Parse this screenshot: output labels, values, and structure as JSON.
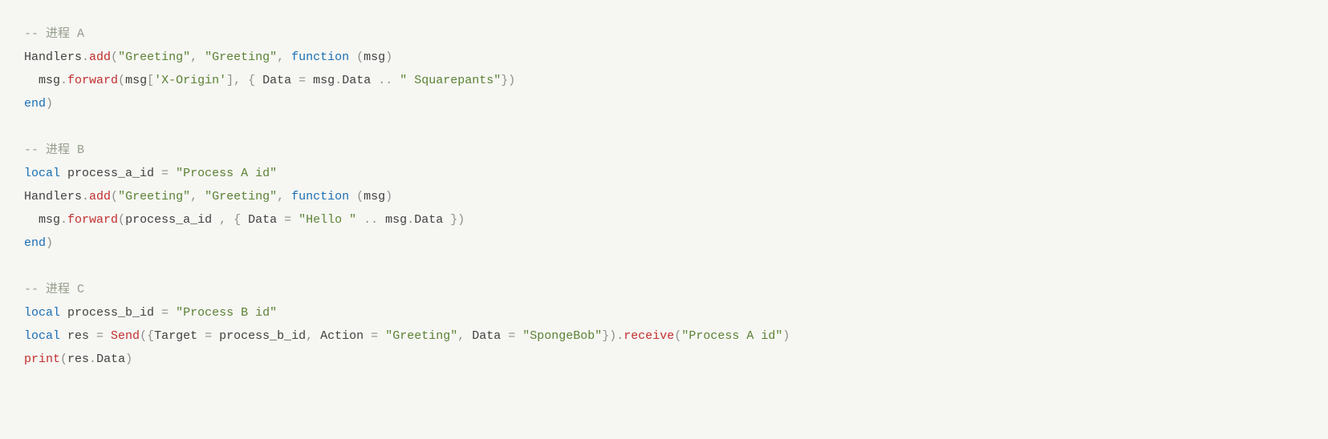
{
  "colors": {
    "background": "#f6f6f3",
    "comment": "#959e8d",
    "identifier": "#414141",
    "method": "#c22f2e",
    "punctuation": "#8e8e8e",
    "string": "#5b8234",
    "keyword": "#1a6fb3"
  },
  "code": {
    "lines": [
      {
        "indent": 0,
        "tokens": [
          {
            "cls": "c-comment",
            "text": "-- 进程 A"
          }
        ]
      },
      {
        "indent": 0,
        "tokens": [
          {
            "cls": "c-ident",
            "text": "Handlers"
          },
          {
            "cls": "c-punct",
            "text": "."
          },
          {
            "cls": "c-method",
            "text": "add"
          },
          {
            "cls": "c-punct",
            "text": "("
          },
          {
            "cls": "c-string",
            "text": "\"Greeting\""
          },
          {
            "cls": "c-punct",
            "text": ", "
          },
          {
            "cls": "c-string",
            "text": "\"Greeting\""
          },
          {
            "cls": "c-punct",
            "text": ", "
          },
          {
            "cls": "c-keyword",
            "text": "function"
          },
          {
            "cls": "c-punct",
            "text": " ("
          },
          {
            "cls": "c-ident",
            "text": "msg"
          },
          {
            "cls": "c-punct",
            "text": ")"
          }
        ]
      },
      {
        "indent": 1,
        "tokens": [
          {
            "cls": "c-ident",
            "text": "msg"
          },
          {
            "cls": "c-punct",
            "text": "."
          },
          {
            "cls": "c-method",
            "text": "forward"
          },
          {
            "cls": "c-punct",
            "text": "("
          },
          {
            "cls": "c-ident",
            "text": "msg"
          },
          {
            "cls": "c-punct",
            "text": "["
          },
          {
            "cls": "c-string",
            "text": "'X-Origin'"
          },
          {
            "cls": "c-punct",
            "text": "], { "
          },
          {
            "cls": "c-ident",
            "text": "Data"
          },
          {
            "cls": "c-op",
            "text": " = "
          },
          {
            "cls": "c-ident",
            "text": "msg"
          },
          {
            "cls": "c-punct",
            "text": "."
          },
          {
            "cls": "c-ident",
            "text": "Data"
          },
          {
            "cls": "c-op",
            "text": " .. "
          },
          {
            "cls": "c-string",
            "text": "\" Squarepants\""
          },
          {
            "cls": "c-punct",
            "text": "})"
          }
        ]
      },
      {
        "indent": 0,
        "tokens": [
          {
            "cls": "c-keyword",
            "text": "end"
          },
          {
            "cls": "c-punct",
            "text": ")"
          }
        ]
      },
      {
        "indent": 0,
        "tokens": []
      },
      {
        "indent": 0,
        "tokens": [
          {
            "cls": "c-comment",
            "text": "-- 进程 B"
          }
        ]
      },
      {
        "indent": 0,
        "tokens": [
          {
            "cls": "c-keyword",
            "text": "local"
          },
          {
            "cls": "c-ident",
            "text": " process_a_id"
          },
          {
            "cls": "c-op",
            "text": " = "
          },
          {
            "cls": "c-string",
            "text": "\"Process A id\""
          }
        ]
      },
      {
        "indent": 0,
        "tokens": [
          {
            "cls": "c-ident",
            "text": "Handlers"
          },
          {
            "cls": "c-punct",
            "text": "."
          },
          {
            "cls": "c-method",
            "text": "add"
          },
          {
            "cls": "c-punct",
            "text": "("
          },
          {
            "cls": "c-string",
            "text": "\"Greeting\""
          },
          {
            "cls": "c-punct",
            "text": ", "
          },
          {
            "cls": "c-string",
            "text": "\"Greeting\""
          },
          {
            "cls": "c-punct",
            "text": ", "
          },
          {
            "cls": "c-keyword",
            "text": "function"
          },
          {
            "cls": "c-punct",
            "text": " ("
          },
          {
            "cls": "c-ident",
            "text": "msg"
          },
          {
            "cls": "c-punct",
            "text": ")"
          }
        ]
      },
      {
        "indent": 1,
        "tokens": [
          {
            "cls": "c-ident",
            "text": "msg"
          },
          {
            "cls": "c-punct",
            "text": "."
          },
          {
            "cls": "c-method",
            "text": "forward"
          },
          {
            "cls": "c-punct",
            "text": "("
          },
          {
            "cls": "c-ident",
            "text": "process_a_id "
          },
          {
            "cls": "c-punct",
            "text": ", { "
          },
          {
            "cls": "c-ident",
            "text": "Data"
          },
          {
            "cls": "c-op",
            "text": " = "
          },
          {
            "cls": "c-string",
            "text": "\"Hello \""
          },
          {
            "cls": "c-op",
            "text": " .. "
          },
          {
            "cls": "c-ident",
            "text": "msg"
          },
          {
            "cls": "c-punct",
            "text": "."
          },
          {
            "cls": "c-ident",
            "text": "Data"
          },
          {
            "cls": "c-punct",
            "text": " })"
          }
        ]
      },
      {
        "indent": 0,
        "tokens": [
          {
            "cls": "c-keyword",
            "text": "end"
          },
          {
            "cls": "c-punct",
            "text": ")"
          }
        ]
      },
      {
        "indent": 0,
        "tokens": []
      },
      {
        "indent": 0,
        "tokens": [
          {
            "cls": "c-comment",
            "text": "-- 进程 C"
          }
        ]
      },
      {
        "indent": 0,
        "tokens": [
          {
            "cls": "c-keyword",
            "text": "local"
          },
          {
            "cls": "c-ident",
            "text": " process_b_id"
          },
          {
            "cls": "c-op",
            "text": " = "
          },
          {
            "cls": "c-string",
            "text": "\"Process B id\""
          }
        ]
      },
      {
        "indent": 0,
        "tokens": [
          {
            "cls": "c-keyword",
            "text": "local"
          },
          {
            "cls": "c-ident",
            "text": " res"
          },
          {
            "cls": "c-op",
            "text": " = "
          },
          {
            "cls": "c-method",
            "text": "Send"
          },
          {
            "cls": "c-punct",
            "text": "({"
          },
          {
            "cls": "c-ident",
            "text": "Target"
          },
          {
            "cls": "c-op",
            "text": " = "
          },
          {
            "cls": "c-ident",
            "text": "process_b_id"
          },
          {
            "cls": "c-punct",
            "text": ", "
          },
          {
            "cls": "c-ident",
            "text": "Action"
          },
          {
            "cls": "c-op",
            "text": " = "
          },
          {
            "cls": "c-string",
            "text": "\"Greeting\""
          },
          {
            "cls": "c-punct",
            "text": ", "
          },
          {
            "cls": "c-ident",
            "text": "Data"
          },
          {
            "cls": "c-op",
            "text": " = "
          },
          {
            "cls": "c-string",
            "text": "\"SpongeBob\""
          },
          {
            "cls": "c-punct",
            "text": "})."
          },
          {
            "cls": "c-method",
            "text": "receive"
          },
          {
            "cls": "c-punct",
            "text": "("
          },
          {
            "cls": "c-string",
            "text": "\"Process A id\""
          },
          {
            "cls": "c-punct",
            "text": ")"
          }
        ]
      },
      {
        "indent": 0,
        "tokens": [
          {
            "cls": "c-method",
            "text": "print"
          },
          {
            "cls": "c-punct",
            "text": "("
          },
          {
            "cls": "c-ident",
            "text": "res"
          },
          {
            "cls": "c-punct",
            "text": "."
          },
          {
            "cls": "c-ident",
            "text": "Data"
          },
          {
            "cls": "c-punct",
            "text": ")"
          }
        ]
      }
    ]
  }
}
